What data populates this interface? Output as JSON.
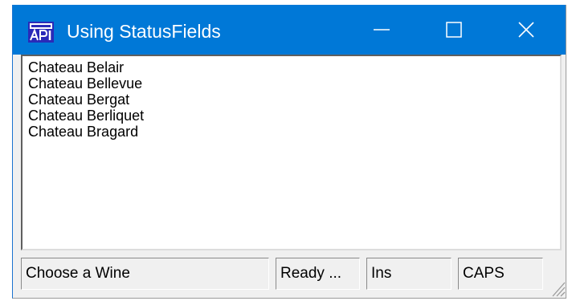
{
  "window": {
    "title": "Using StatusFields",
    "app_icon": "api-app-icon",
    "controls": [
      "minimize-icon",
      "maximize-icon",
      "close-icon"
    ],
    "titlebar_color": "#0078d7"
  },
  "listbox": {
    "items": [
      "Chateau Belair",
      "Chateau Bellevue",
      "Chateau Bergat",
      "Chateau Berliquet",
      "Chateau Bragard"
    ]
  },
  "status": {
    "message": "Choose a Wine",
    "state": "Ready ...",
    "insert": "Ins",
    "caps": "CAPS"
  }
}
